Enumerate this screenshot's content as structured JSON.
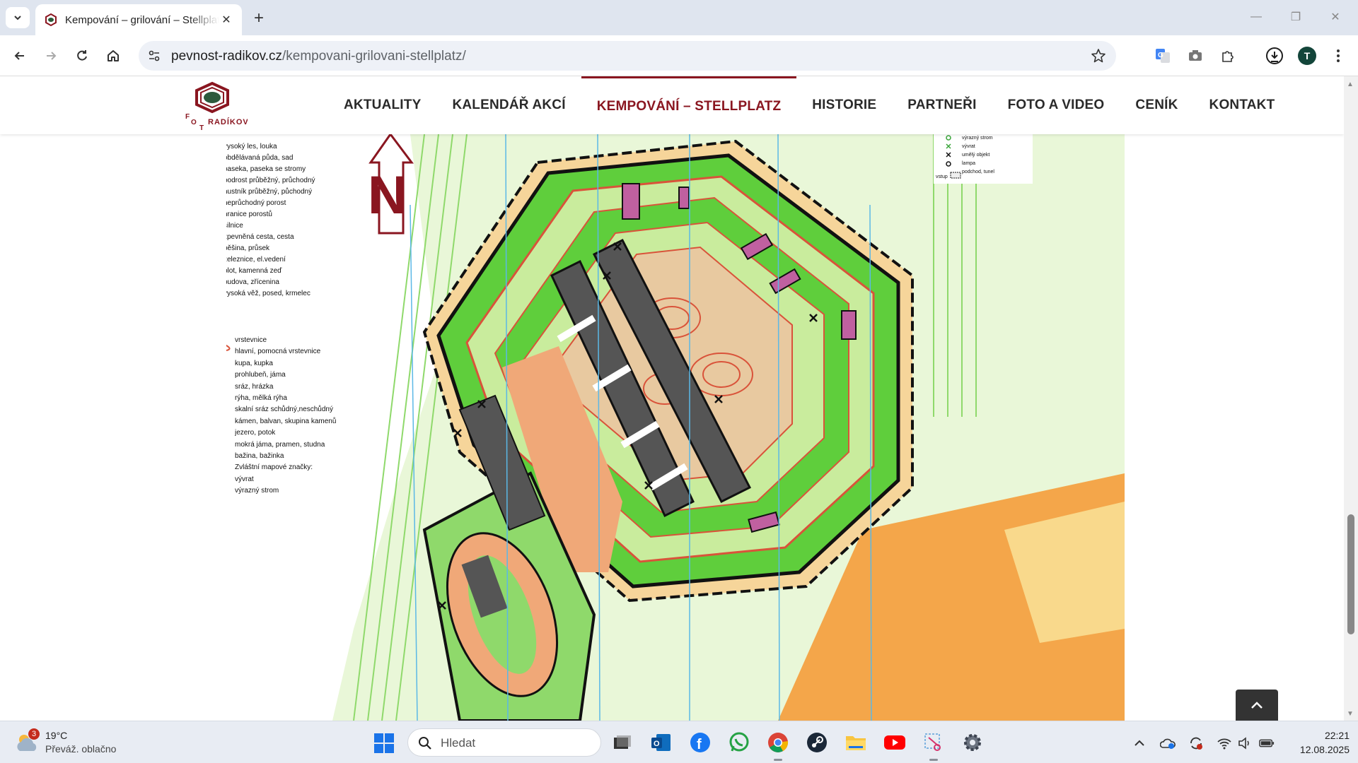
{
  "browser": {
    "tab": {
      "title": "Kempování – grilování – Stellplatz"
    },
    "address": {
      "domain": "pevnost-radikov.cz",
      "path": "/kempovani-grilovani-stellplatz/"
    },
    "profile_initial": "T"
  },
  "site": {
    "logo_text": "RADÍKOV",
    "nav": [
      {
        "label": "AKTUALITY"
      },
      {
        "label": "KALENDÁŘ AKCÍ"
      },
      {
        "label": "KEMPOVÁNÍ – STELLPLATZ",
        "active": true
      },
      {
        "label": "HISTORIE"
      },
      {
        "label": "PARTNEŘI"
      },
      {
        "label": "FOTO A VIDEO"
      },
      {
        "label": "CENÍK"
      },
      {
        "label": "KONTAKT"
      }
    ]
  },
  "map": {
    "north_label": "N",
    "legend_left": [
      "vysoký les, louka",
      "obdělávaná půda, sad",
      "paseka, paseka se stromy",
      "podrost průběžný, průchodný",
      "hustník průběžný, půchodný",
      "neprůchodný porost",
      "hranice porostů",
      "silnice",
      "zpevněná cesta, cesta",
      "pěšina, průsek",
      "železnice, el.vedení",
      "plot, kamenná zeď",
      "budova, zřícenina",
      "vysoká věž, posed, krmelec"
    ],
    "legend_left2": [
      "vrstevnice",
      "hlavní, pomocná vrstevnice",
      "kupa, kupka",
      "prohlubeň, jáma",
      "sráz, hrázka",
      "rýha, mělká rýha",
      "skalní sráz schůdný,neschůdný",
      "kámen, balvan, skupina kamenů",
      "jezero, potok",
      "mokrá jáma, pramen, studna",
      "bažina, bažinka",
      "Zvláštní mapové značky:",
      "vývrat",
      "výrazný strom"
    ],
    "legend_right": [
      "výrazný strom",
      "vývrat",
      "umělý objekt",
      "lampa",
      "podchod, tunel"
    ],
    "legend_right_prefix": "vstup"
  },
  "taskbar": {
    "weather": {
      "badge": "3",
      "temp": "19°C",
      "condition": "Převáž. oblačno"
    },
    "search_placeholder": "Hledat",
    "clock": {
      "time": "22:21",
      "date": "12.08.2025"
    }
  },
  "colors": {
    "accent": "#8a1620",
    "map_green": "#5fce3c",
    "map_light_green": "#c9ec9d",
    "map_orange": "#f4a64a",
    "map_building": "#555555"
  }
}
